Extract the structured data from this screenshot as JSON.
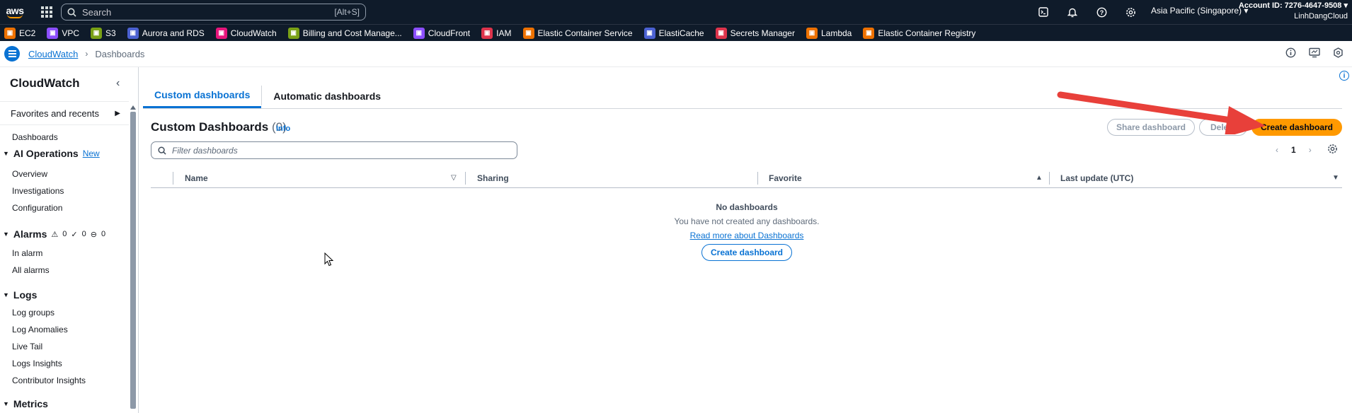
{
  "topbar": {
    "logo": "aws",
    "search_placeholder": "Search",
    "search_shortcut": "[Alt+S]",
    "icons": [
      "cloudshell-icon",
      "bell-icon",
      "help-icon",
      "gear-icon"
    ],
    "region": "Asia Pacific (Singapore) ▾",
    "account_id": "Account ID: 7276-4647-9508 ▾",
    "account_name": "LinhDangCloud"
  },
  "favorites": [
    {
      "label": "EC2",
      "color": "#ed7100"
    },
    {
      "label": "VPC",
      "color": "#8c4fff"
    },
    {
      "label": "S3",
      "color": "#7aa116"
    },
    {
      "label": "Aurora and RDS",
      "color": "#4b61d1"
    },
    {
      "label": "CloudWatch",
      "color": "#e7157b"
    },
    {
      "label": "Billing and Cost Manage...",
      "color": "#7aa116"
    },
    {
      "label": "CloudFront",
      "color": "#8c4fff"
    },
    {
      "label": "IAM",
      "color": "#dd344c"
    },
    {
      "label": "Elastic Container Service",
      "color": "#ed7100"
    },
    {
      "label": "ElastiCache",
      "color": "#4b61d1"
    },
    {
      "label": "Secrets Manager",
      "color": "#dd344c"
    },
    {
      "label": "Lambda",
      "color": "#ed7100"
    },
    {
      "label": "Elastic Container Registry",
      "color": "#ed7100"
    }
  ],
  "breadcrumb": {
    "parent": "CloudWatch",
    "current": "Dashboards"
  },
  "sidebar": {
    "title": "CloudWatch",
    "favorites_label": "Favorites and recents",
    "dashboards": "Dashboards",
    "ai_ops": {
      "label": "AI Operations",
      "badge": "New",
      "items": [
        "Overview",
        "Investigations",
        "Configuration"
      ]
    },
    "alarms": {
      "label": "Alarms",
      "count_alarm": "0",
      "count_ok": "0",
      "count_insufficient": "0",
      "items": [
        "In alarm",
        "All alarms"
      ]
    },
    "logs": {
      "label": "Logs",
      "items": [
        "Log groups",
        "Log Anomalies",
        "Live Tail",
        "Logs Insights",
        "Contributor Insights"
      ]
    },
    "metrics": {
      "label": "Metrics"
    }
  },
  "main": {
    "tabs": [
      "Custom dashboards",
      "Automatic dashboards"
    ],
    "heading": "Custom Dashboards",
    "count": "(0)",
    "info": "Info",
    "share_button": "Share dashboard",
    "delete_button": "Delete",
    "create_button": "Create dashboard",
    "filter_placeholder": "Filter dashboards",
    "page": "1",
    "columns": [
      "Name",
      "Sharing",
      "Favorite",
      "Last update (UTC)"
    ],
    "empty": {
      "title": "No dashboards",
      "message": "You have not created any dashboards.",
      "link": "Read more about Dashboards",
      "button": "Create dashboard"
    }
  },
  "colors": {
    "accent": "#0972d3",
    "primary_button": "#ff9900",
    "annotation_arrow": "#e8403a",
    "nav_bg": "#0f1b2a"
  }
}
